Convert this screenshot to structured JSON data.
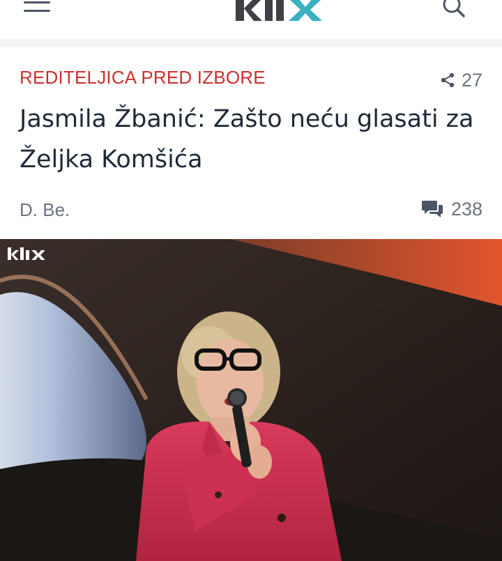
{
  "header": {
    "logo_text": "klix",
    "menu_icon": "hamburger-menu-icon",
    "search_icon": "search-icon"
  },
  "article": {
    "kicker": "REDITELJICA PRED IZBORE",
    "share_count": "27",
    "title": "Jasmila Žbanić: Zašto neću glasati za Željka Komšića",
    "author": "D. Be.",
    "comment_count": "238"
  },
  "image": {
    "watermark": "klix",
    "description_icon": "photo-woman-speaking-microphone"
  },
  "colors": {
    "kicker": "#cc2f2f",
    "logo_gray": "#3f3f46",
    "logo_teal": "#3ab0c3",
    "muted": "#6b7280"
  }
}
